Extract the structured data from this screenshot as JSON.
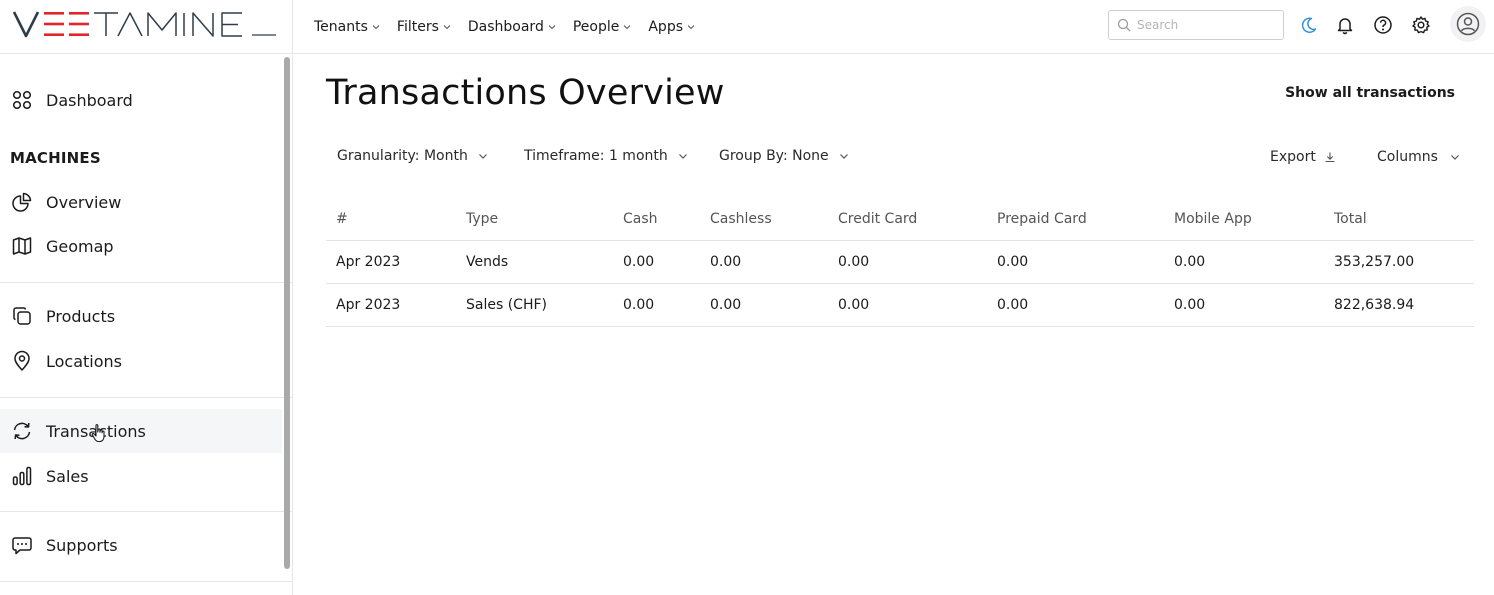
{
  "brand": {
    "logo_text": "VEETAMINE",
    "accent": "#e3242b",
    "dark": "#2d3e4a"
  },
  "topnav": [
    {
      "label": "Tenants"
    },
    {
      "label": "Filters"
    },
    {
      "label": "Dashboard"
    },
    {
      "label": "People"
    },
    {
      "label": "Apps"
    }
  ],
  "search": {
    "placeholder": "Search",
    "value": ""
  },
  "topbar_icons": [
    "moon-icon",
    "bell-icon",
    "help-icon",
    "gear-icon",
    "user-avatar-icon"
  ],
  "sidebar": {
    "dashboard": "Dashboard",
    "machines_section": "MACHINES",
    "overview": "Overview",
    "geomap": "Geomap",
    "products": "Products",
    "locations": "Locations",
    "transactions": "Transactions",
    "sales": "Sales",
    "supports": "Supports",
    "active_item": "Transactions"
  },
  "page": {
    "title": "Transactions Overview",
    "show_all": "Show all transactions"
  },
  "filters": {
    "granularity": "Granularity: Month",
    "timeframe": "Timeframe: 1 month",
    "group_by": "Group By: None",
    "export": "Export",
    "columns": "Columns"
  },
  "table": {
    "headers": [
      "#",
      "Type",
      "Cash",
      "Cashless",
      "Credit Card",
      "Prepaid Card",
      "Mobile App",
      "Total"
    ],
    "rows": [
      [
        "Apr 2023",
        "Vends",
        "0.00",
        "0.00",
        "0.00",
        "0.00",
        "0.00",
        "353,257.00"
      ],
      [
        "Apr 2023",
        "Sales (CHF)",
        "0.00",
        "0.00",
        "0.00",
        "0.00",
        "0.00",
        "822,638.94"
      ]
    ]
  }
}
